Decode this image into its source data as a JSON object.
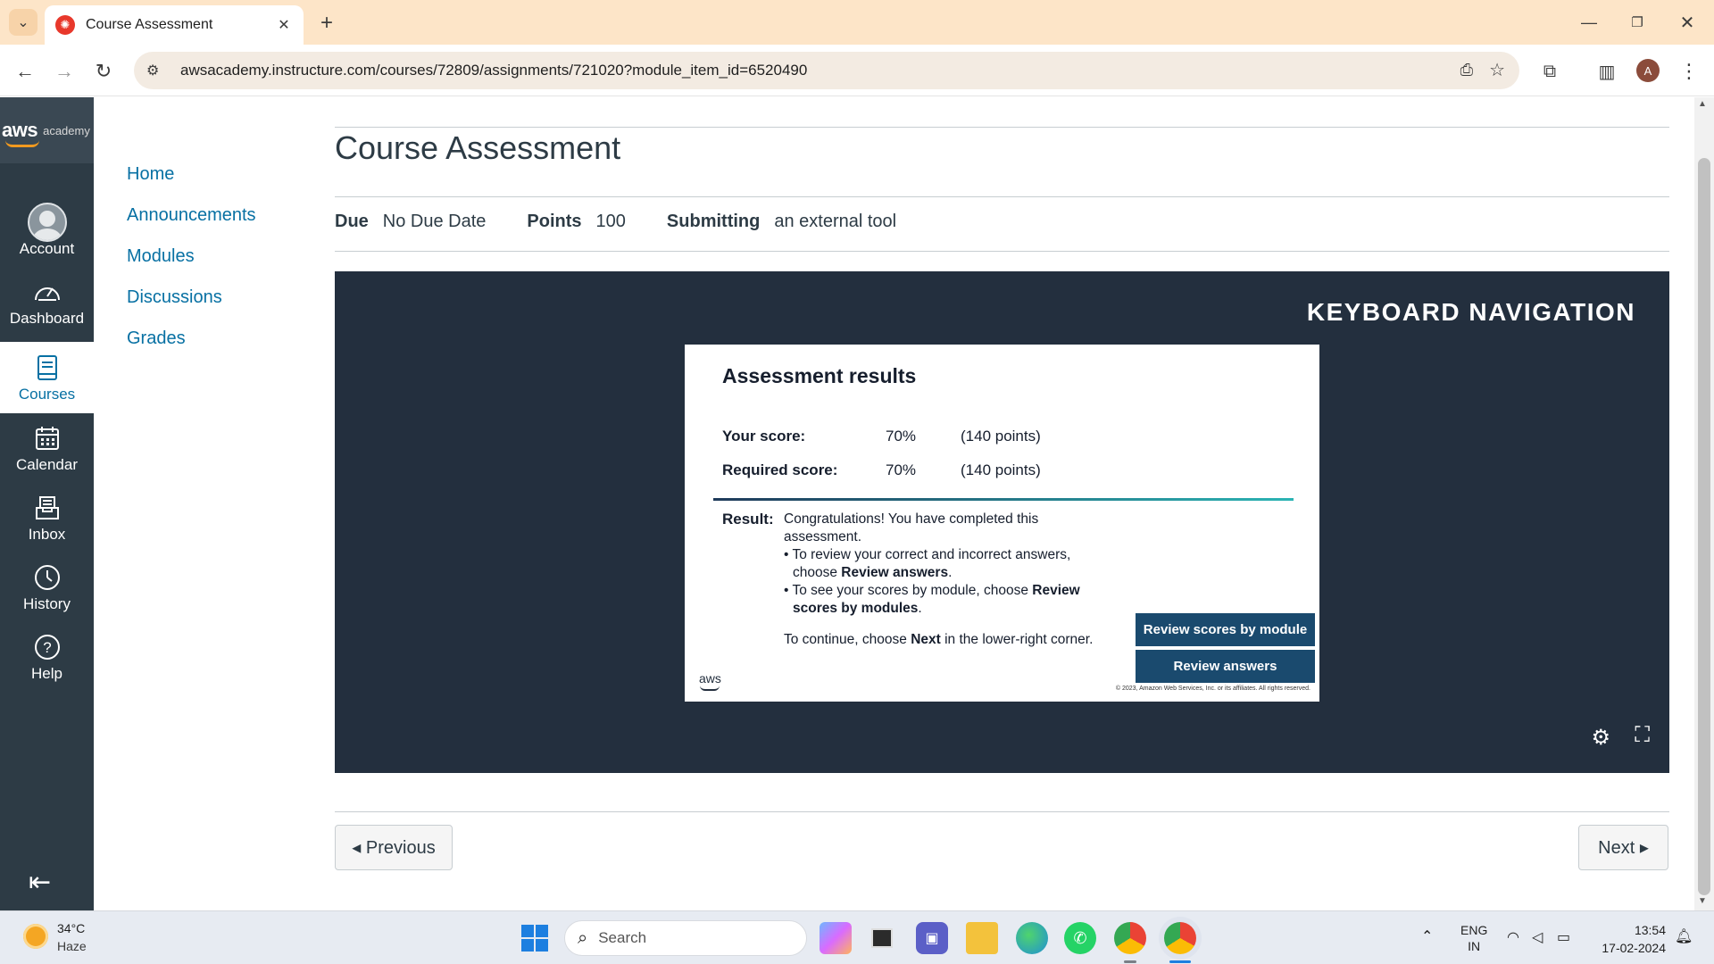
{
  "browser": {
    "tab_title": "Course Assessment",
    "url": "awsacademy.instructure.com/courses/72809/assignments/721020?module_item_id=6520490",
    "profile_initial": "A"
  },
  "global_nav": {
    "logo_aws": "aws",
    "logo_academy": "academy",
    "items": [
      {
        "label": "Account",
        "icon": "avatar-icon"
      },
      {
        "label": "Dashboard",
        "icon": "speedometer-icon"
      },
      {
        "label": "Courses",
        "icon": "book-icon",
        "active": true
      },
      {
        "label": "Calendar",
        "icon": "calendar-icon"
      },
      {
        "label": "Inbox",
        "icon": "inbox-icon"
      },
      {
        "label": "History",
        "icon": "clock-icon"
      },
      {
        "label": "Help",
        "icon": "question-icon"
      }
    ]
  },
  "course_nav": [
    "Home",
    "Announcements",
    "Modules",
    "Discussions",
    "Grades"
  ],
  "page": {
    "title": "Course Assessment",
    "due_label": "Due",
    "due_value": "No Due Date",
    "points_label": "Points",
    "points_value": "100",
    "submitting_label": "Submitting",
    "submitting_value": "an external tool"
  },
  "player": {
    "keyboard_nav": "KEYBOARD NAVIGATION",
    "slide": {
      "title": "Assessment results",
      "your_score_label": "Your score:",
      "your_score_pct": "70%",
      "your_score_points": "(140 points)",
      "required_score_label": "Required score:",
      "required_score_pct": "70%",
      "required_score_points": "(140 points)",
      "result_label": "Result:",
      "result_intro": "Congratulations! You have completed this assessment.",
      "bullet1_prefix": "To review your correct and incorrect answers, choose ",
      "bullet1_bold": "Review answers",
      "bullet2_prefix": "To see your scores by module, choose ",
      "bullet2_bold": "Review scores by modules",
      "continue_prefix": "To continue, choose ",
      "continue_bold": "Next",
      "continue_suffix": " in the lower-right corner.",
      "btn_scores": "Review scores by module",
      "btn_answers": "Review answers",
      "aws_mark": "aws",
      "copyright": "© 2023, Amazon Web Services, Inc. or its affiliates. All rights reserved."
    }
  },
  "pager": {
    "previous": "◂ Previous",
    "next": "Next ▸"
  },
  "taskbar": {
    "temp": "34°C",
    "condition": "Haze",
    "search_placeholder": "Search",
    "lang_top": "ENG",
    "lang_bottom": "IN",
    "time": "13:54",
    "date": "17-02-2024"
  },
  "colors": {
    "canvas_nav": "#2d3b45",
    "link": "#0770a3",
    "player_bg": "#232f3e",
    "slide_button": "#1a4a6e"
  }
}
